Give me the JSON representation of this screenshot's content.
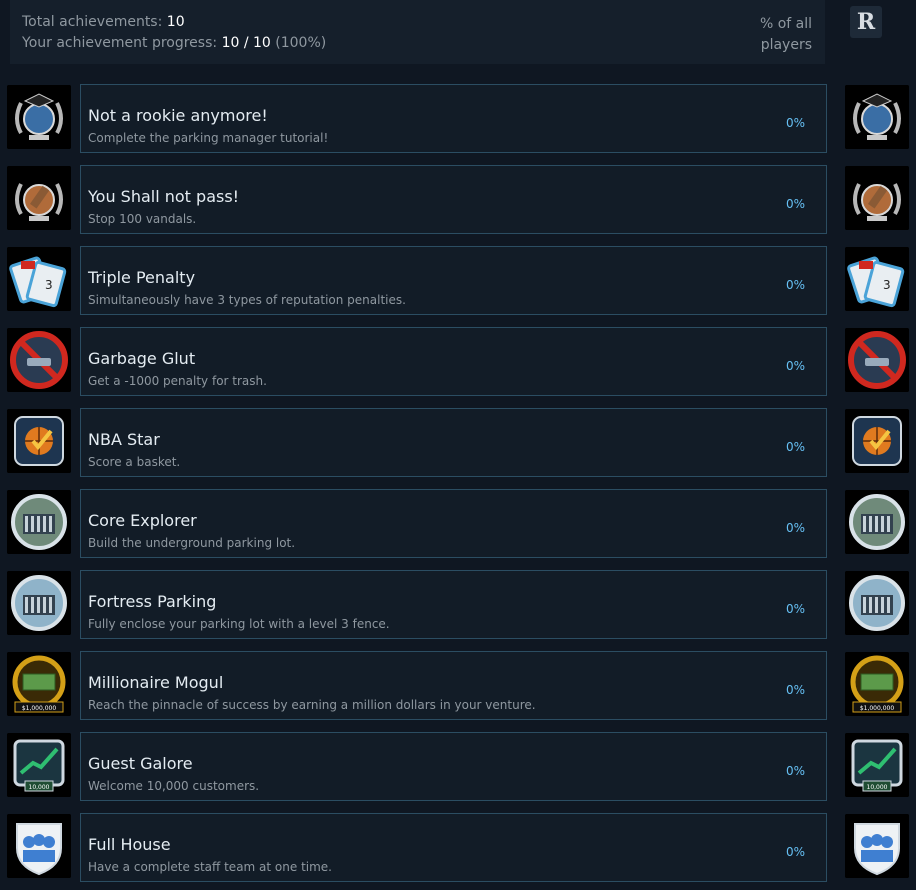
{
  "summary": {
    "total_label": "Total achievements: ",
    "total_value": "10",
    "progress_label": "Your achievement progress: ",
    "progress_value": "10 / 10",
    "progress_pct": " (100%)",
    "column_header_line1": "% of all",
    "column_header_line2": "players",
    "progress_fraction": 1.0
  },
  "user_badge": {
    "letter": "R"
  },
  "achievements": [
    {
      "title": "Not a rookie anymore!",
      "desc": "Complete the parking manager tutorial!",
      "pct": "0%",
      "icon": "graduation-cap-laurel-icon",
      "color": "#3a6ea5"
    },
    {
      "title": "You Shall not pass!",
      "desc": "Stop 100 vandals.",
      "pct": "0%",
      "icon": "hammer-laurel-icon",
      "color": "#b06b3a"
    },
    {
      "title": "Triple Penalty",
      "desc": "Simultaneously have 3 types of reputation penalties.",
      "pct": "0%",
      "icon": "penalty-tickets-icon",
      "color": "#4aa3d8"
    },
    {
      "title": "Garbage Glut",
      "desc": "Get a -1000 penalty for trash.",
      "pct": "0%",
      "icon": "no-trash-penalty-icon",
      "color": "#d0281f"
    },
    {
      "title": "NBA Star",
      "desc": "Score a basket.",
      "pct": "0%",
      "icon": "basketball-check-icon",
      "color": "#e07a1f"
    },
    {
      "title": "Core Explorer",
      "desc": "Build the underground parking lot.",
      "pct": "0%",
      "icon": "underground-garage-icon",
      "color": "#6f8a7a"
    },
    {
      "title": "Fortress Parking",
      "desc": "Fully enclose your parking lot with a level 3 fence.",
      "pct": "0%",
      "icon": "fence-fortress-icon",
      "color": "#8fb3c9"
    },
    {
      "title": "Millionaire Mogul",
      "desc": "Reach the pinnacle of success by earning a million dollars in your venture.",
      "pct": "0%",
      "icon": "money-stack-medal-icon",
      "color": "#d4a017",
      "badge_text": "$1,000,000"
    },
    {
      "title": "Guest Galore",
      "desc": "Welcome 10,000 customers.",
      "pct": "0%",
      "icon": "growth-chart-icon",
      "color": "#2fbf71",
      "badge_text": "10,000"
    },
    {
      "title": "Full House",
      "desc": "Have a complete staff team at one time.",
      "pct": "0%",
      "icon": "staff-team-shield-icon",
      "color": "#3f7fd1"
    }
  ]
}
